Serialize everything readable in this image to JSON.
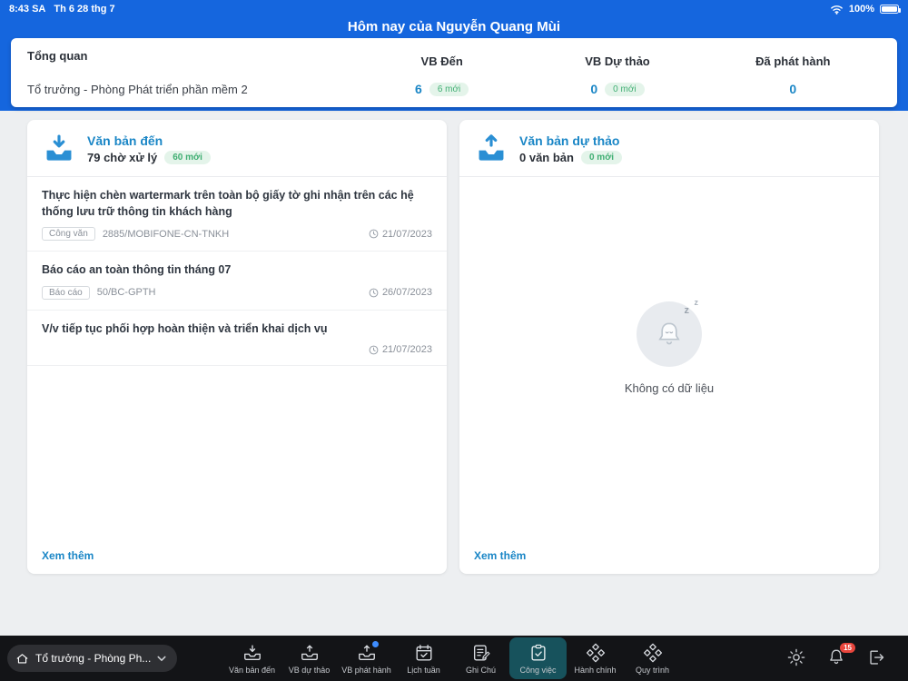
{
  "status_bar": {
    "time": "8:43 SA",
    "date": "Th 6 28 thg 7",
    "battery": "100%"
  },
  "header": {
    "title": "Hôm nay của Nguyễn Quang Mùi"
  },
  "overview": {
    "title": "Tổng quan",
    "subtitle": "Tổ trưởng - Phòng Phát triển phần mềm 2",
    "stats": [
      {
        "label": "VB Đến",
        "value": "6",
        "badge": "6 mới"
      },
      {
        "label": "VB Dự thảo",
        "value": "0",
        "badge": "0 mới"
      },
      {
        "label": "Đã phát hành",
        "value": "0"
      }
    ]
  },
  "inbox_card": {
    "title": "Văn bản đến",
    "count_text": "79 chờ xử lý",
    "badge": "60 mới",
    "items": [
      {
        "title": "Thực hiện chèn wartermark trên toàn bộ giấy tờ ghi nhận trên các hệ thống lưu trữ thông tin khách hàng",
        "tag": "Công văn",
        "ref": "2885/MOBIFONE-CN-TNKH",
        "date": "21/07/2023"
      },
      {
        "title": "Báo cáo an toàn thông tin tháng 07",
        "tag": "Báo cáo",
        "ref": "50/BC-GPTH",
        "date": "26/07/2023"
      },
      {
        "title": "V/v tiếp tục phối hợp hoàn thiện và triển khai dịch vụ",
        "date": "21/07/2023"
      }
    ],
    "more_label": "Xem thêm"
  },
  "draft_card": {
    "title": "Văn bản dự thảo",
    "count_text": "0 văn bản",
    "badge": "0 mới",
    "empty_text": "Không có dữ liệu",
    "more_label": "Xem thêm"
  },
  "bottom_nav": {
    "role_selector": "Tổ trưởng - Phòng Ph...",
    "items": [
      {
        "label": "Văn bản đến",
        "icon": "inbox-arrow-down"
      },
      {
        "label": "VB dự thảo",
        "icon": "inbox-arrow-up"
      },
      {
        "label": "VB phát hành",
        "icon": "inbox-arrow-up",
        "badge_dot": true
      },
      {
        "label": "Lịch tuần",
        "icon": "calendar-check"
      },
      {
        "label": "Ghi Chú",
        "icon": "note-pencil"
      },
      {
        "label": "Công việc",
        "icon": "clipboard-check",
        "active": true
      },
      {
        "label": "Hành chính",
        "icon": "modules-diamonds"
      },
      {
        "label": "Quy trình",
        "icon": "workflow-diamonds"
      }
    ],
    "notification_count": "15"
  }
}
